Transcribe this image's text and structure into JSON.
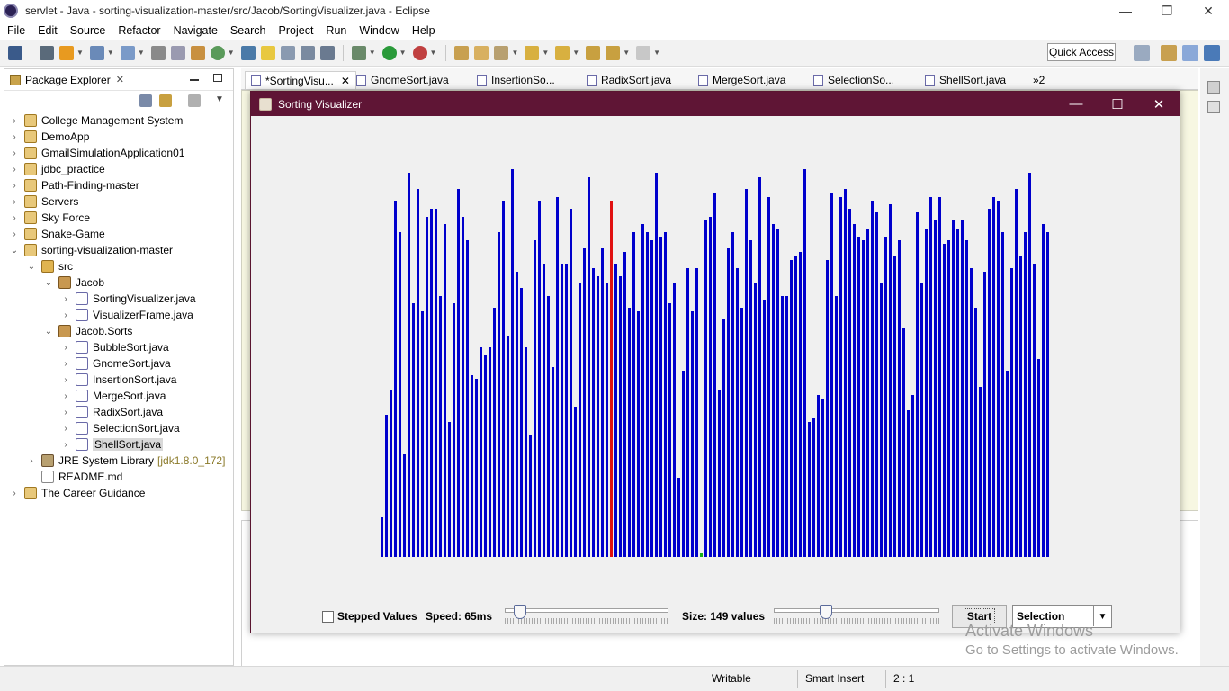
{
  "window": {
    "title": "servlet - Java - sorting-visualization-master/src/Jacob/SortingVisualizer.java - Eclipse"
  },
  "menu": [
    "File",
    "Edit",
    "Source",
    "Refactor",
    "Navigate",
    "Search",
    "Project",
    "Run",
    "Window",
    "Help"
  ],
  "toolbar": {
    "quick_access": "Quick Access"
  },
  "package_explorer": {
    "title": "Package Explorer",
    "items": [
      {
        "label": "College Management System",
        "depth": 0,
        "kind": "proj",
        "expanded": false
      },
      {
        "label": "DemoApp",
        "depth": 0,
        "kind": "proj",
        "expanded": false
      },
      {
        "label": "GmailSimulationApplication01",
        "depth": 0,
        "kind": "proj",
        "expanded": false
      },
      {
        "label": "jdbc_practice",
        "depth": 0,
        "kind": "proj",
        "expanded": false
      },
      {
        "label": "Path-Finding-master",
        "depth": 0,
        "kind": "proj",
        "expanded": false
      },
      {
        "label": "Servers",
        "depth": 0,
        "kind": "proj",
        "expanded": false
      },
      {
        "label": "Sky Force",
        "depth": 0,
        "kind": "proj",
        "expanded": false
      },
      {
        "label": "Snake-Game",
        "depth": 0,
        "kind": "proj",
        "expanded": false
      },
      {
        "label": "sorting-visualization-master",
        "depth": 0,
        "kind": "proj",
        "expanded": true
      },
      {
        "label": "src",
        "depth": 1,
        "kind": "src",
        "expanded": true
      },
      {
        "label": "Jacob",
        "depth": 2,
        "kind": "pkg",
        "expanded": true
      },
      {
        "label": "SortingVisualizer.java",
        "depth": 3,
        "kind": "java",
        "expanded": false
      },
      {
        "label": "VisualizerFrame.java",
        "depth": 3,
        "kind": "java",
        "expanded": false
      },
      {
        "label": "Jacob.Sorts",
        "depth": 2,
        "kind": "pkg",
        "expanded": true
      },
      {
        "label": "BubbleSort.java",
        "depth": 3,
        "kind": "java",
        "expanded": false
      },
      {
        "label": "GnomeSort.java",
        "depth": 3,
        "kind": "java",
        "expanded": false
      },
      {
        "label": "InsertionSort.java",
        "depth": 3,
        "kind": "java",
        "expanded": false
      },
      {
        "label": "MergeSort.java",
        "depth": 3,
        "kind": "java",
        "expanded": false
      },
      {
        "label": "RadixSort.java",
        "depth": 3,
        "kind": "java",
        "expanded": false
      },
      {
        "label": "SelectionSort.java",
        "depth": 3,
        "kind": "java",
        "expanded": false
      },
      {
        "label": "ShellSort.java",
        "depth": 3,
        "kind": "java",
        "expanded": false,
        "selected": true
      },
      {
        "label": "JRE System Library",
        "depth": 1,
        "kind": "jre",
        "expanded": false,
        "suffix": "[jdk1.8.0_172]"
      },
      {
        "label": "README.md",
        "depth": 1,
        "kind": "md",
        "leaf": true
      },
      {
        "label": "The Career Guidance",
        "depth": 0,
        "kind": "proj",
        "expanded": false
      }
    ]
  },
  "editor_tabs": [
    {
      "label": "*SortingVisu...",
      "active": true
    },
    {
      "label": "GnomeSort.java"
    },
    {
      "label": "InsertionSo..."
    },
    {
      "label": "RadixSort.java"
    },
    {
      "label": "MergeSort.java"
    },
    {
      "label": "SelectionSo..."
    },
    {
      "label": "ShellSort.java"
    }
  ],
  "editor_overflow": "»2",
  "status": {
    "writable": "Writable",
    "insert_mode": "Smart Insert",
    "position": "2 : 1"
  },
  "visualizer": {
    "title": "Sorting Visualizer",
    "stepped_label": "Stepped Values",
    "stepped_checked": false,
    "speed_label": "Speed: 65ms",
    "speed_fraction": 0.06,
    "size_label": "Size: 149 values",
    "size_fraction": 0.3,
    "start_label": "Start",
    "algorithm": "Selection",
    "colors": {
      "bar": "#0000cc",
      "highlight": "#e01010",
      "marker": "#18b018"
    },
    "highlight_index": 51,
    "marker_index": 71,
    "values": [
      10,
      36,
      42,
      90,
      82,
      26,
      97,
      64,
      93,
      62,
      86,
      88,
      88,
      66,
      84,
      34,
      64,
      93,
      86,
      80,
      46,
      45,
      53,
      51,
      53,
      63,
      82,
      90,
      56,
      98,
      72,
      68,
      53,
      31,
      80,
      90,
      74,
      66,
      48,
      91,
      74,
      74,
      88,
      38,
      69,
      78,
      96,
      73,
      71,
      78,
      69,
      90,
      74,
      71,
      77,
      63,
      82,
      62,
      84,
      82,
      80,
      97,
      81,
      82,
      64,
      69,
      20,
      47,
      73,
      62,
      73,
      1,
      85,
      86,
      92,
      42,
      60,
      78,
      82,
      73,
      63,
      93,
      80,
      69,
      96,
      65,
      91,
      84,
      83,
      66,
      66,
      75,
      76,
      77,
      98,
      34,
      35,
      41,
      40,
      75,
      92,
      66,
      91,
      93,
      88,
      84,
      81,
      80,
      83,
      90,
      87,
      69,
      81,
      89,
      76,
      80,
      58,
      37,
      41,
      87,
      69,
      83,
      91,
      85,
      91,
      79,
      80,
      85,
      83,
      85,
      80,
      73,
      63,
      43,
      72,
      88,
      91,
      90,
      82,
      47,
      73,
      93,
      76,
      82,
      97,
      74,
      50,
      84,
      82
    ],
    "watermark": {
      "line1": "Activate Windows",
      "line2": "Go to Settings to activate Windows."
    }
  }
}
